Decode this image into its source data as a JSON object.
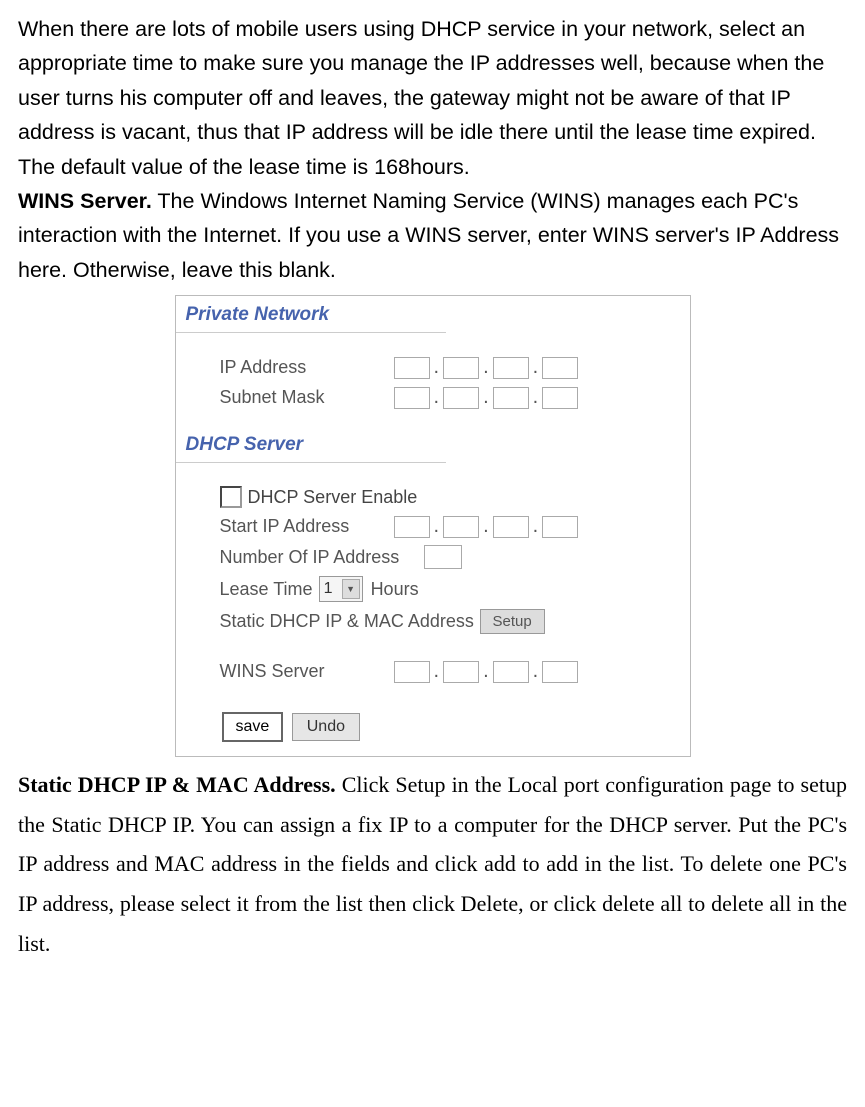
{
  "para1_parts": {
    "p1": "When there are lots of mobile users using DHCP service in your network, select an appropriate time to make sure you manage the IP addresses well, because when the user turns his computer off and leaves, the gateway might not be aware of that IP address is vacant, thus that IP address will be idle there until the lease time expired. The default value of the lease time is 168hours.",
    "wins_label": "WINS Server.",
    "wins_text": " The Windows Internet Naming Service (WINS) manages each PC's interaction with the Internet. If you use a WINS server, enter WINS server's IP Address here. Otherwise, leave this blank."
  },
  "panel": {
    "private_network": {
      "title": "Private Network",
      "ip_label": "IP Address",
      "mask_label": "Subnet Mask"
    },
    "dhcp_server": {
      "title": "DHCP Server",
      "enable_label": " DHCP Server Enable",
      "start_ip_label": "Start IP Address",
      "num_ip_label": "Number Of IP Address",
      "lease_label": "Lease Time",
      "lease_value": "1",
      "hours_label": "Hours",
      "static_label": "Static DHCP IP & MAC Address",
      "setup_btn": "Setup",
      "wins_label": "WINS Server"
    },
    "buttons": {
      "save": "save",
      "undo": "Undo"
    }
  },
  "para2_parts": {
    "static_label": "Static DHCP IP & MAC Address.",
    "static_text": " Click Setup in the Local port configuration page to setup the Static DHCP IP. You can assign a fix IP to a computer for the DHCP server. Put the PC's IP address and MAC address in the fields and click add to add in the list. To delete one PC's IP address, please select it from the list then click Delete, or click delete all to delete all in the list."
  }
}
